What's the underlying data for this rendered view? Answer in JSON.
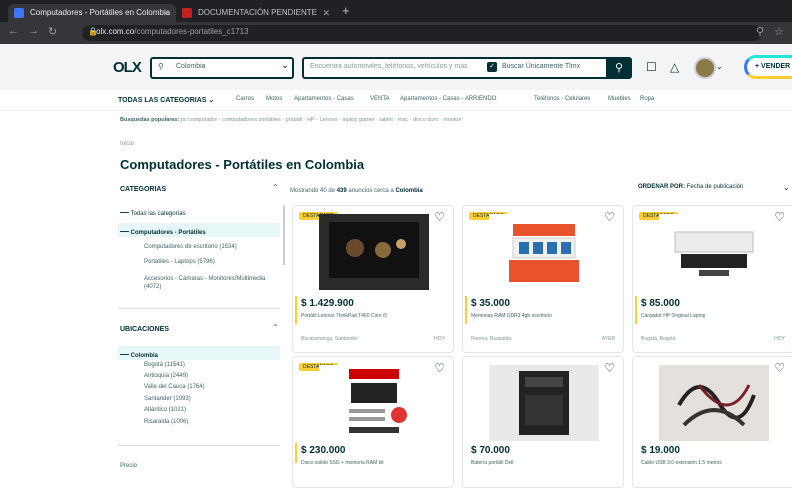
{
  "browser": {
    "tabs": [
      {
        "label": "Computadores - Portátiles en Colombia",
        "icon": "olx-favicon"
      },
      {
        "label": "DOCUMENTACIÓN PENDIENTE",
        "icon": "document-favicon"
      }
    ],
    "url_domain": "olx.com.co",
    "url_path": "/computadores-portatiles_c1713"
  },
  "header": {
    "logo": "OLX",
    "location": "Colombia",
    "search_placeholder": "Encuentra automóviles, teléfonos, vehículos y más",
    "checkbox_label": "Buscar Únicamente Tlmx",
    "sell_label": "VENDER"
  },
  "nav": {
    "all_categories": "TODAS LAS CATEGORIAS",
    "links": [
      "Carros",
      "Motos",
      "Apartamentos - Casas",
      "VENTA",
      "Apartamentos - Casas - ARRIENDO",
      "Teléfonos - Celulares",
      "Muebles",
      "Ropa"
    ]
  },
  "popular": {
    "label": "Búsquedas populares:",
    "items": "pc computador · computadores portátiles · portatil · HP · Lenovo · laptop gamer · tablet · mac · disco duro · monitor"
  },
  "breadcrumb": "Inicio",
  "page_title": "Computadores - Portátiles en Colombia",
  "sidebar": {
    "categories_title": "CATEGORIAS",
    "all_categories": "Todas las categorías",
    "selected_category": "Computadores - Portátiles",
    "subcategories": [
      "Computadores de escritorio (1534)",
      "Portátiles - Laptops (5796)",
      "Accesorios - Cámaras - Monitores/Multimedia",
      "(4072)"
    ],
    "locations_title": "UBICACIONES",
    "selected_location": "Colombia",
    "locations": [
      "Bogotá (11541)",
      "Antioquia (2449)",
      "Valle del Cauca (1764)",
      "Santander (1093)",
      "Atlántico (1021)",
      "Risaralda (1006)"
    ],
    "bottom_label": "Precio"
  },
  "results": {
    "summary_prefix": "Mostrando 40 de",
    "summary_count": "439",
    "summary_suffix": "anuncios cerca a",
    "summary_place": "Colombia",
    "sort_label": "ORDENAR POR:",
    "sort_value": "Fecha de publicación"
  },
  "cards": [
    {
      "badge": "DESTACADO",
      "price": "$ 1.429.900",
      "title": "Portátil Lenovo ThinkPad T460 Core i5",
      "location": "Bucaramanga, Santander",
      "date": "HOY",
      "img": "laptop"
    },
    {
      "badge": "DESTACADO",
      "price": "$ 35.000",
      "title": "Memorias RAM DDR3 4gb escritorio",
      "location": "Pereira, Risaralda",
      "date": "AYER",
      "img": "product-box"
    },
    {
      "badge": "DESTACADO",
      "price": "$ 85.000",
      "title": "Cargador HP Original Laptop",
      "location": "Bogotá, Bogotá",
      "date": "HOY",
      "img": "device"
    },
    {
      "badge": "DESTACADO",
      "price": "$ 230.000",
      "title": "Disco solido SSD + memoria RAM kit",
      "location": "",
      "date": "",
      "img": "flyer"
    },
    {
      "badge": "",
      "price": "$ 70.000",
      "title": "Batería portátil Dell",
      "location": "",
      "date": "",
      "img": "battery"
    },
    {
      "badge": "",
      "price": "$ 19.000",
      "title": "Cable USB 3.0 extensión 1.5 metros",
      "location": "",
      "date": "",
      "img": "cable"
    }
  ]
}
